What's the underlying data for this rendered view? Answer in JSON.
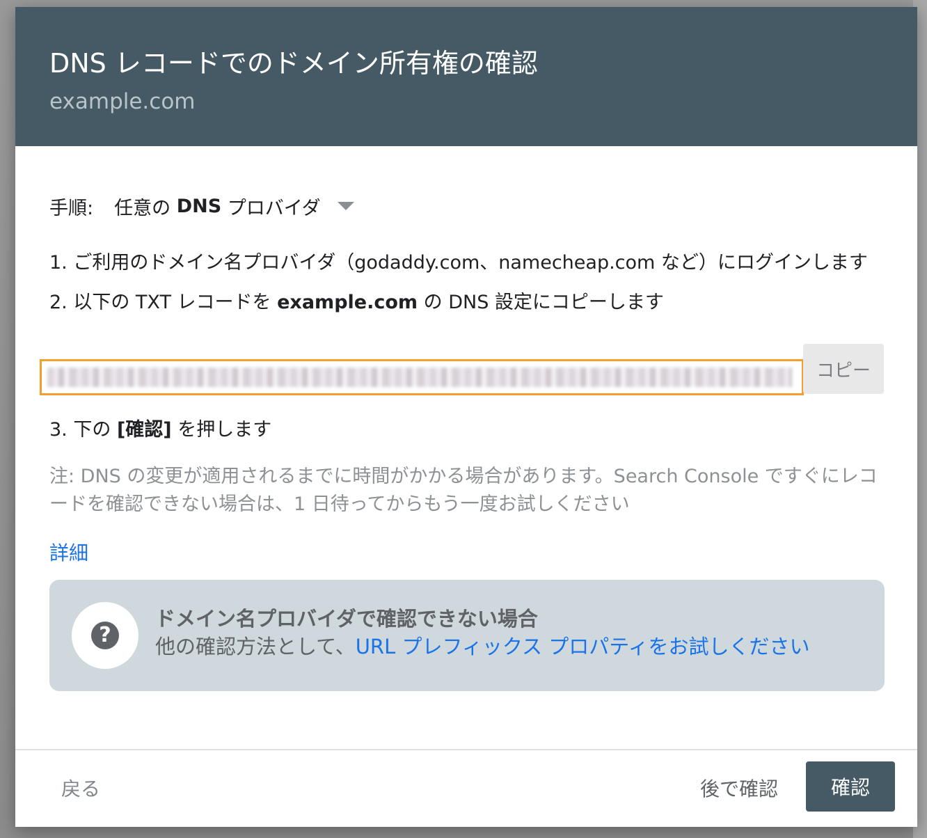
{
  "dialog": {
    "title": "DNS レコードでのドメイン所有権の確認",
    "subtitle": "example.com"
  },
  "steps": {
    "label": "手順:",
    "provider_prefix": "任意の",
    "provider_bold": "DNS",
    "provider_suffix": "プロバイダ",
    "step1": "1. ご利用のドメイン名プロバイダ（godaddy.com、namecheap.com など）にログインします",
    "step2_prefix": "2. 以下の TXT レコードを",
    "step2_bold": "example.com",
    "step2_suffix": "の DNS 設定にコピーします",
    "step3_prefix": "3. 下の",
    "step3_bold": "[確認]",
    "step3_suffix": "を押します"
  },
  "record": {
    "copy_label": "コピー"
  },
  "note": "注: DNS の変更が適用されるまでに時間がかかる場合があります。Search Console ですぐにレコードを確認できない場合は、1 日待ってからもう一度お試しください",
  "details_link": "詳細",
  "help_card": {
    "icon": "question-mark-icon",
    "title": "ドメイン名プロバイダで確認できない場合",
    "desc_prefix": "他の確認方法として、",
    "desc_link": "URL プレフィックス プロパティをお試しください"
  },
  "footer": {
    "back_label": "戻る",
    "later_label": "後で確認",
    "confirm_label": "確認"
  },
  "colors": {
    "header_bg": "#455a64",
    "accent_link": "#1a73e8",
    "field_highlight": "#f3a02a",
    "help_card_bg": "#cfd8dc"
  }
}
